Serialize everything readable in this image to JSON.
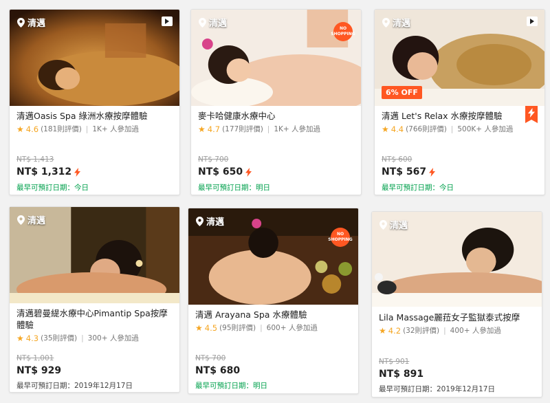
{
  "colors": {
    "accent": "#ff5722",
    "star": "#f5a623",
    "green": "#00a04c"
  },
  "cards": [
    {
      "location": "清邁",
      "title": "清邁Oasis Spa 綠洲水療按摩體驗",
      "rating": "4.6",
      "reviews": "(181則評價)",
      "participants": "1K+ 人參加過",
      "original_price": "NT$ 1,413",
      "price": "NT$ 1,312",
      "date": "最早可預訂日期：今日",
      "badge": "play"
    },
    {
      "location": "清邁",
      "title": "麥卡哈健康水療中心",
      "rating": "4.7",
      "reviews": "(177則評價)",
      "participants": "1K+ 人參加過",
      "original_price": "NT$ 700",
      "price": "NT$ 650",
      "date": "最早可預訂日期：明日",
      "badge": "no-shopping",
      "badge_text": "NO SHOPPING"
    },
    {
      "location": "清邁",
      "title": "清邁 Let's Relax 水療按摩體驗",
      "rating": "4.4",
      "reviews": "(766則評價)",
      "participants": "500K+ 人參加過",
      "original_price": "NT$ 600",
      "price": "NT$ 567",
      "date": "最早可預訂日期：今日",
      "badge": "play",
      "discount": "6% OFF"
    },
    {
      "location": "清邁",
      "title": "清邁碧曼緹水療中心Pimantip Spa按摩體驗",
      "rating": "4.3",
      "reviews": "(35則評價)",
      "participants": "300+ 人參加過",
      "original_price": "NT$ 1,001",
      "price": "NT$ 929",
      "date": "最早可預訂日期：2019年12月17日"
    },
    {
      "location": "清邁",
      "title": "清邁 Arayana Spa 水療體驗",
      "rating": "4.5",
      "reviews": "(95則評價)",
      "participants": "600+ 人參加過",
      "original_price": "NT$ 700",
      "price": "NT$ 680",
      "date": "最早可預訂日期：明日",
      "badge": "no-shopping",
      "badge_text": "NO SHOPPING"
    },
    {
      "location": "清邁",
      "title": "Lila Massage麗菈女子監獄泰式按摩",
      "rating": "4.2",
      "reviews": "(32則評價)",
      "participants": "400+ 人參加過",
      "original_price": "NT$ 901",
      "price": "NT$ 891",
      "date": "最早可預訂日期：2019年12月17日"
    }
  ]
}
